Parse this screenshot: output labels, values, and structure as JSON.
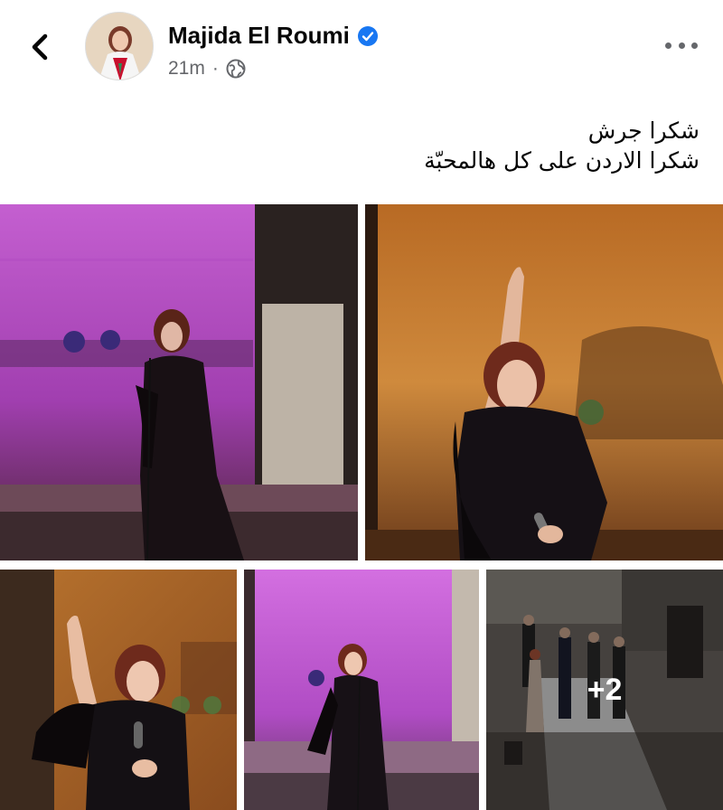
{
  "header": {
    "back_icon": "chevron-left-icon",
    "author_name": "Majida El Roumi",
    "verified_icon": "verified-badge-icon",
    "timestamp": "21m",
    "separator": "·",
    "audience_icon": "globe-icon",
    "more_icon": "more-horizontal-icon"
  },
  "post": {
    "caption_lines": [
      "شكرا جرش",
      "شكرا الاردن على كل هالمحبّة"
    ]
  },
  "gallery": {
    "more_count_label": "+2",
    "photos": [
      {
        "description": "singer on purple-lit stage"
      },
      {
        "description": "singer raising arm on orange-lit stage"
      },
      {
        "description": "singer waving on orange-lit stage"
      },
      {
        "description": "singer on purple-lit stage, full view"
      },
      {
        "description": "performers bowing on stage"
      }
    ]
  },
  "colors": {
    "accent": "#1877f2",
    "secondary_text": "#65676b",
    "purple_light": "#c65fcf",
    "orange_light": "#c97a2e"
  }
}
